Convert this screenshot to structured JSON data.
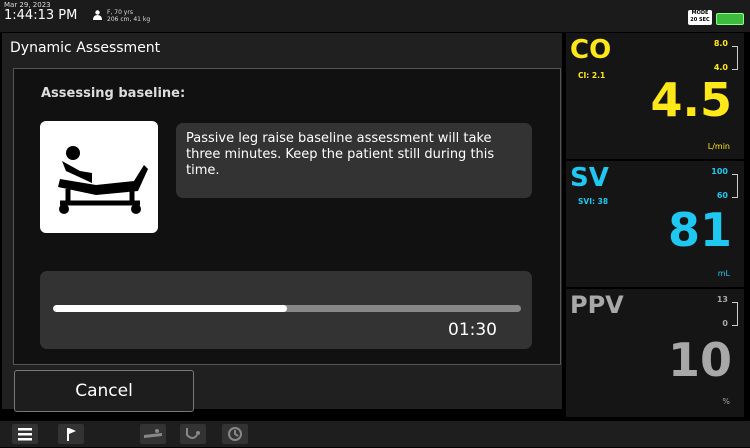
{
  "statusbar": {
    "date": "Mar 29, 2023",
    "time": "1:44:13 PM",
    "patient_line1": "F, 70 yrs",
    "patient_line2": "206 cm, 41 kg",
    "mode_line1": "MODE",
    "mode_line2": "20 SEC"
  },
  "dialog": {
    "title": "Dynamic Assessment",
    "heading": "Assessing baseline:",
    "message": "Passive leg raise baseline assessment will take three minutes. Keep the patient still during this time.",
    "progress_fraction": 0.5,
    "timer": "01:30",
    "cancel_label": "Cancel"
  },
  "tiles": {
    "co": {
      "label": "CO",
      "sub": "CI: 2.1",
      "high": "8.0",
      "low": "4.0",
      "value": "4.5",
      "unit": "L/min",
      "color": "#ffe81a"
    },
    "sv": {
      "label": "SV",
      "sub": "SVI: 38",
      "high": "100",
      "low": "60",
      "value": "81",
      "unit": "mL",
      "color": "#1ec8f0"
    },
    "ppv": {
      "label": "PPV",
      "high": "13",
      "low": "0",
      "value": "10",
      "unit": "%",
      "color": "#a8a8a8"
    }
  },
  "icons": [
    "person-icon",
    "bed-icon",
    "menu-icon",
    "flag-icon",
    "bed-toolbar-icon",
    "stethoscope-icon",
    "history-icon",
    "battery-icon"
  ]
}
